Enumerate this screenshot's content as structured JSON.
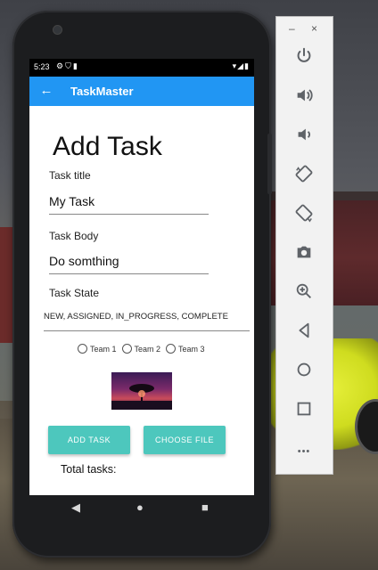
{
  "status_bar": {
    "time": "5:23"
  },
  "app_bar": {
    "title": "TaskMaster"
  },
  "form": {
    "heading": "Add Task",
    "title_label": "Task title",
    "title_value": "My Task",
    "body_label": "Task Body",
    "body_value": "Do somthing",
    "state_label": "Task State",
    "state_options": "NEW, ASSIGNED, IN_PROGRESS, COMPLETE",
    "teams": [
      "Team 1",
      "Team 2",
      "Team 3"
    ],
    "add_button": "ADD TASK",
    "choose_button": "CHOOSE FILE",
    "total_label": "Total tasks:"
  },
  "emulator": {
    "minimize": "–",
    "close": "×",
    "more": "•••"
  }
}
